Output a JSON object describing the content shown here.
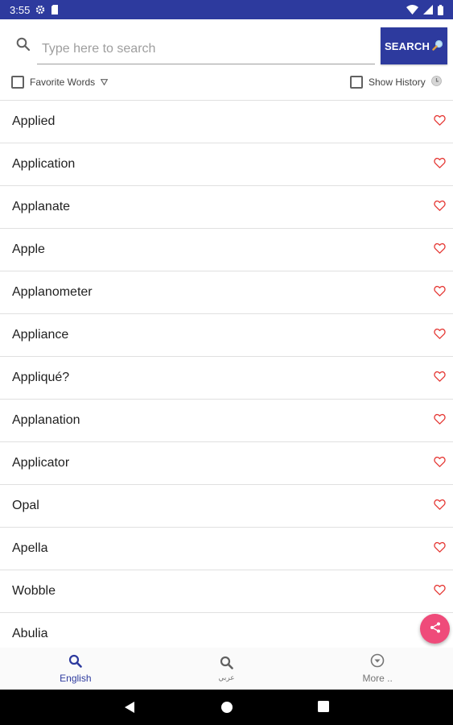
{
  "status_bar": {
    "time": "3:55",
    "color": "#2d3a9e"
  },
  "search": {
    "placeholder": "Type here to search",
    "value": "",
    "button_label": "SEARCH"
  },
  "options": {
    "favorite_words_label": "Favorite Words",
    "favorite_words_checked": false,
    "show_history_label": "Show History",
    "show_history_checked": false
  },
  "words": [
    {
      "label": "Applied"
    },
    {
      "label": "Application"
    },
    {
      "label": "Applanate"
    },
    {
      "label": "Apple"
    },
    {
      "label": "Applanometer"
    },
    {
      "label": "Appliance"
    },
    {
      "label": "Appliqué?"
    },
    {
      "label": "Applanation"
    },
    {
      "label": "Applicator"
    },
    {
      "label": "Opal"
    },
    {
      "label": "Apella"
    },
    {
      "label": "Wobble"
    },
    {
      "label": "Abulia"
    }
  ],
  "bottom_nav": {
    "tabs": [
      {
        "label": "English",
        "icon": "search-icon",
        "active": true
      },
      {
        "label": "عربي",
        "icon": "search-icon",
        "active": false
      },
      {
        "label": "More ..",
        "icon": "chevron-down-circle-icon",
        "active": false
      }
    ]
  },
  "colors": {
    "primary": "#2d3a9e",
    "heart": "#e53935",
    "fab": "#ef4b7a"
  }
}
